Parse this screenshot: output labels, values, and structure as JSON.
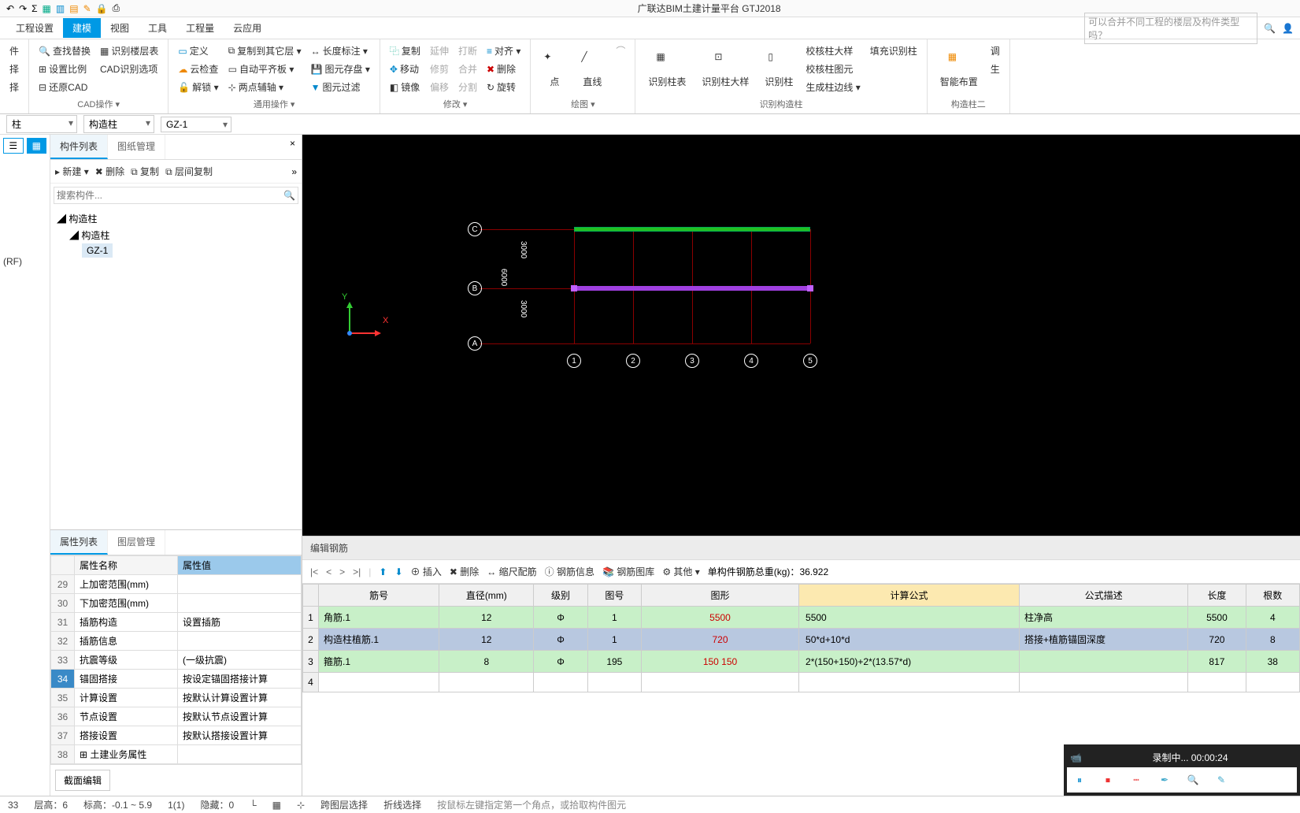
{
  "title": "广联达BIM土建计量平台 GTJ2018",
  "quick_icons": [
    "undo-icon",
    "redo-icon",
    "sum-icon",
    "chart-icon",
    "table-icon",
    "export-icon",
    "edit-icon",
    "lock-icon",
    "print-icon"
  ],
  "menu": {
    "tabs": [
      "工程设置",
      "建模",
      "视图",
      "工具",
      "工程量",
      "云应用"
    ],
    "active": "建模",
    "search_placeholder": "可以合并不同工程的楼层及构件类型吗？"
  },
  "ribbon": {
    "groups": [
      {
        "label": "",
        "cols": [
          [
            "件",
            "择",
            "择"
          ]
        ]
      },
      {
        "label": "CAD操作 ▾",
        "cols": [
          [
            "查找替换",
            "设置比例",
            "还原CAD"
          ],
          [
            "识别楼层表",
            "CAD识别选项"
          ]
        ]
      },
      {
        "label": "通用操作 ▾",
        "cols": [
          [
            "定义",
            "云检查",
            "解锁 ▾"
          ],
          [
            "复制到其它层 ▾",
            "自动平齐板 ▾",
            "两点辅轴 ▾"
          ],
          [
            "长度标注 ▾",
            "图元存盘 ▾",
            "图元过滤"
          ]
        ]
      },
      {
        "label": "修改 ▾",
        "cols": [
          [
            "复制",
            "移动",
            "镜像"
          ],
          [
            "延伸",
            "修剪",
            "偏移"
          ],
          [
            "打断",
            "合并",
            "分割"
          ],
          [
            "对齐 ▾",
            "删除",
            "旋转"
          ]
        ]
      },
      {
        "label": "绘图 ▾",
        "bigs": [
          "点",
          "直线"
        ],
        "extra": [
          ""
        ]
      },
      {
        "label": "识别构造柱",
        "bigs": [
          "识别柱表",
          "识别柱大样",
          "识别柱"
        ],
        "cols": [
          [
            "校核柱大样",
            "校核柱图元",
            "生成柱边线 ▾"
          ],
          [
            "填充识别柱"
          ]
        ]
      },
      {
        "label": "构造柱二",
        "bigs": [
          "智能布置"
        ],
        "cols": [
          [
            "调",
            "生"
          ]
        ]
      }
    ]
  },
  "combos": [
    "柱",
    "构造柱",
    "GZ-1"
  ],
  "left_tree": "(RF)",
  "component_panel": {
    "tabs": [
      "构件列表",
      "图纸管理"
    ],
    "active_tab": "构件列表",
    "toolbar": [
      "新建",
      "删除",
      "复制",
      "层间复制"
    ],
    "search_placeholder": "搜索构件...",
    "tree": [
      "构造柱",
      "构造柱",
      "GZ-1"
    ]
  },
  "props_panel": {
    "tabs": [
      "属性列表",
      "图层管理"
    ],
    "active_tab": "属性列表",
    "headers": [
      "属性名称",
      "属性值"
    ],
    "rows": [
      {
        "n": "29",
        "name": "上加密范围(mm)",
        "val": ""
      },
      {
        "n": "30",
        "name": "下加密范围(mm)",
        "val": ""
      },
      {
        "n": "31",
        "name": "插筋构造",
        "val": "设置插筋"
      },
      {
        "n": "32",
        "name": "插筋信息",
        "val": ""
      },
      {
        "n": "33",
        "name": "抗震等级",
        "val": "(一级抗震)"
      },
      {
        "n": "34",
        "name": "锚固搭接",
        "val": "按设定锚固搭接计算",
        "sel": true
      },
      {
        "n": "35",
        "name": "计算设置",
        "val": "按默认计算设置计算"
      },
      {
        "n": "36",
        "name": "节点设置",
        "val": "按默认节点设置计算"
      },
      {
        "n": "37",
        "name": "搭接设置",
        "val": "按默认搭接设置计算"
      },
      {
        "n": "38",
        "name": "土建业务属性",
        "val": "",
        "expand": true
      }
    ],
    "edit_btn": "截面编辑"
  },
  "canvas": {
    "row_labels": [
      "C",
      "B",
      "A"
    ],
    "col_labels": [
      "1",
      "2",
      "3",
      "4",
      "5"
    ],
    "dim_v": [
      "3000",
      "3000"
    ],
    "dim_v_total": "6000",
    "axis": {
      "y": "Y",
      "x": "X"
    }
  },
  "rebar_panel": {
    "title": "编辑钢筋",
    "toolbar": {
      "nav": [
        "|<",
        "<",
        ">",
        ">|"
      ],
      "actions": [
        "插入",
        "删除",
        "缩尺配筋",
        "钢筋信息",
        "钢筋图库",
        "其他 ▾"
      ],
      "weight_label": "单构件钢筋总重(kg)：",
      "weight": "36.922"
    },
    "headers": [
      "筋号",
      "直径(mm)",
      "级别",
      "图号",
      "图形",
      "计算公式",
      "公式描述",
      "长度",
      "根数"
    ],
    "rows": [
      {
        "n": "1",
        "name": "角筋.1",
        "d": "12",
        "lvl": "Φ",
        "pic": "1",
        "shape": "5500",
        "formula": "5500",
        "desc": "柱净高",
        "len": "5500",
        "qty": "4",
        "bg": "green"
      },
      {
        "n": "2",
        "name": "构造柱植筋.1",
        "d": "12",
        "lvl": "Φ",
        "pic": "1",
        "shape": "720",
        "formula": "50*d+10*d",
        "desc": "搭接+植筋锚固深度",
        "len": "720",
        "qty": "8",
        "bg": "blue"
      },
      {
        "n": "3",
        "name": "箍筋.1",
        "d": "8",
        "lvl": "Φ",
        "pic": "195",
        "shape": "150  150",
        "formula": "2*(150+150)+2*(13.57*d)",
        "desc": "",
        "len": "817",
        "qty": "38",
        "bg": "green"
      },
      {
        "n": "4",
        "name": "",
        "d": "",
        "lvl": "",
        "pic": "",
        "shape": "",
        "formula": "",
        "desc": "",
        "len": "",
        "qty": ""
      }
    ]
  },
  "statusbar": {
    "items": [
      "33",
      "层高：6",
      "标高：-0.1 ~ 5.9",
      "1(1)",
      "隐藏：0",
      "跨图层选择",
      "折线选择",
      "按鼠标左键指定第一个角点，或拾取构件图元"
    ]
  },
  "recording": {
    "label": "录制中...",
    "time": "00:00:24"
  }
}
